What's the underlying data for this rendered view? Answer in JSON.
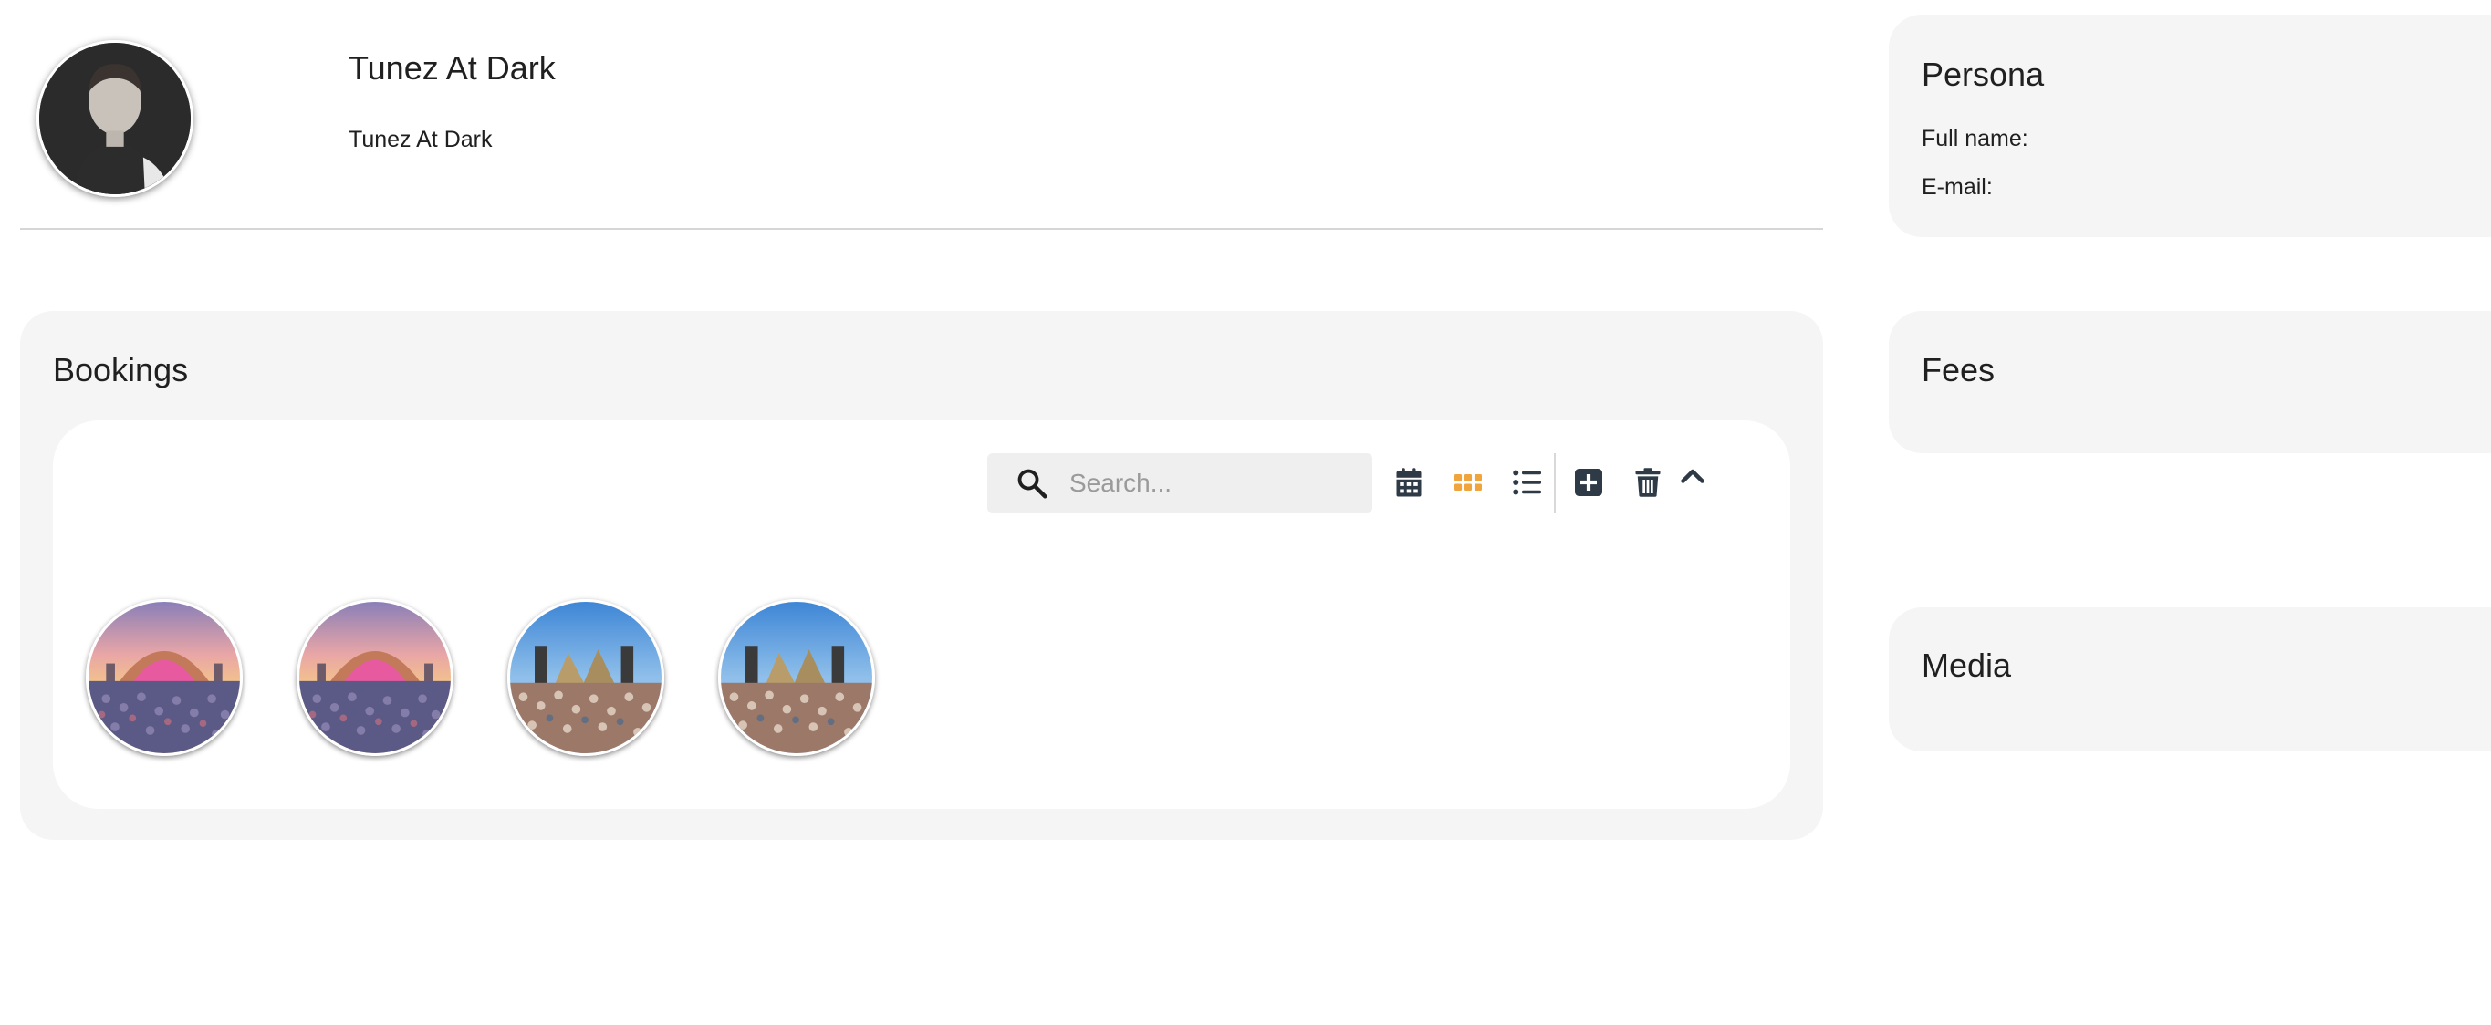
{
  "profile": {
    "name": "Tunez At Dark",
    "subtitle": "Tunez At Dark"
  },
  "persona": {
    "title": "Persona",
    "full_name_label": "Full name:",
    "email_label": "E-mail:"
  },
  "fees": {
    "title": "Fees"
  },
  "media": {
    "title": "Media"
  },
  "bookings": {
    "title": "Bookings",
    "search": {
      "placeholder": "Search...",
      "value": ""
    },
    "toolbar": {
      "icons": [
        "calendar-icon",
        "grid-view-icon",
        "list-view-icon",
        "add-square-icon",
        "trash-icon",
        "chevron-up-icon"
      ],
      "active_view": "grid",
      "active_color": "#f0a53c",
      "icon_color": "#2f3a47"
    },
    "items": [
      {
        "scene": "sunset stage crowd"
      },
      {
        "scene": "sunset stage crowd"
      },
      {
        "scene": "daytime festival crowd"
      },
      {
        "scene": "daytime festival crowd"
      }
    ]
  }
}
